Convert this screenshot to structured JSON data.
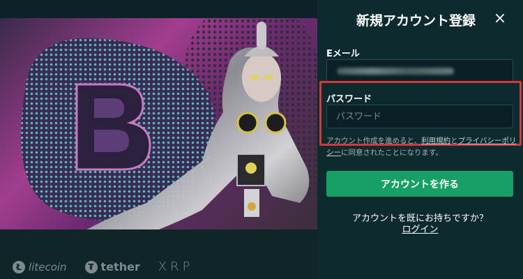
{
  "panel": {
    "title": "新規アカウント登録",
    "close_icon": "close-icon"
  },
  "email": {
    "label": "Eメール",
    "value_obscured": true
  },
  "password": {
    "label": "パスワード",
    "placeholder": "パスワード"
  },
  "terms": {
    "prefix": "アカウント作成を進めると、",
    "terms_link": "利用規約",
    "and": "と",
    "privacy_link": "プライバシーポリシー",
    "suffix": "に同意されたことになります。"
  },
  "create_button": "アカウントを作る",
  "have_account_text": "アカウントを既にお持ちですか？",
  "login_link": "ログイン",
  "partner_logos": [
    {
      "name": "litecoin",
      "icon": "litecoin-icon",
      "badge": "Ł"
    },
    {
      "name": "tether",
      "icon": "tether-icon",
      "badge": "₮"
    },
    {
      "name": "XRP",
      "icon": "xrp-icon",
      "badge": ""
    }
  ],
  "colors": {
    "panel_bg": "#0d2a2e",
    "primary_button": "#17a063",
    "highlight_border": "#d9353a"
  }
}
